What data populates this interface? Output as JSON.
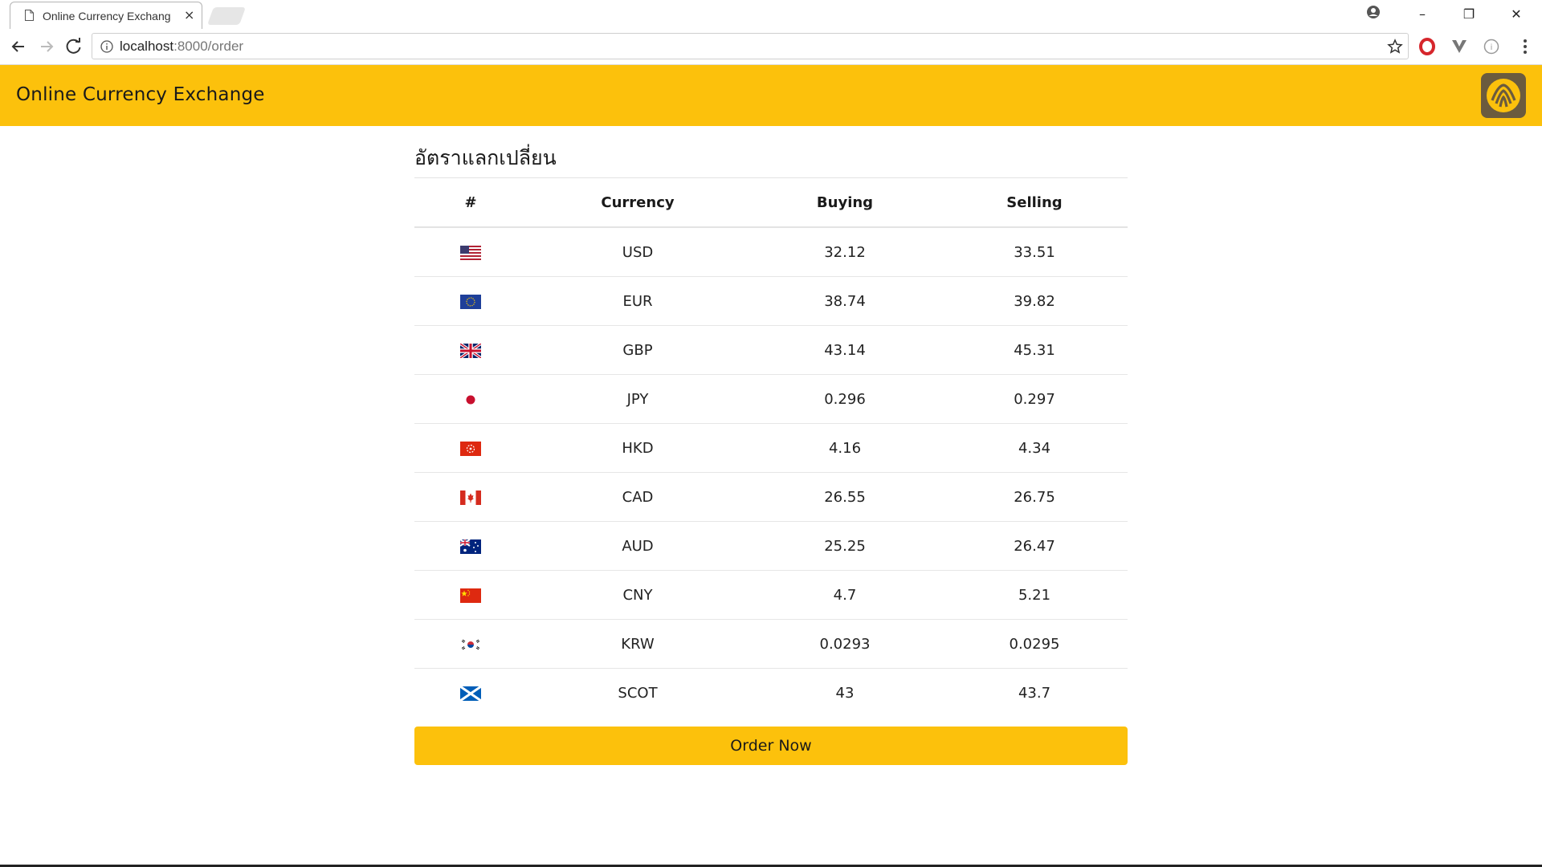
{
  "browser": {
    "tab_title": "Online Currency Exchang",
    "tab_close": "×",
    "url_host": "localhost",
    "url_path": ":8000/order",
    "window_controls": {
      "minimize": "–",
      "restore": "❐",
      "close": "✕"
    }
  },
  "header": {
    "brand": "Online Currency Exchange",
    "accent_color": "#fcc10c",
    "logo_icon": "krungsri-bank-logo-icon"
  },
  "main": {
    "title": "อัตราแลกเปลี่ยน",
    "columns": [
      "#",
      "Currency",
      "Buying",
      "Selling"
    ],
    "rows": [
      {
        "flag": "us-flag-icon",
        "currency": "USD",
        "buying": "32.12",
        "selling": "33.51"
      },
      {
        "flag": "eu-flag-icon",
        "currency": "EUR",
        "buying": "38.74",
        "selling": "39.82"
      },
      {
        "flag": "uk-flag-icon",
        "currency": "GBP",
        "buying": "43.14",
        "selling": "45.31"
      },
      {
        "flag": "jp-flag-icon",
        "currency": "JPY",
        "buying": "0.296",
        "selling": "0.297"
      },
      {
        "flag": "hk-flag-icon",
        "currency": "HKD",
        "buying": "4.16",
        "selling": "4.34"
      },
      {
        "flag": "ca-flag-icon",
        "currency": "CAD",
        "buying": "26.55",
        "selling": "26.75"
      },
      {
        "flag": "au-flag-icon",
        "currency": "AUD",
        "buying": "25.25",
        "selling": "26.47"
      },
      {
        "flag": "cn-flag-icon",
        "currency": "CNY",
        "buying": "4.7",
        "selling": "5.21"
      },
      {
        "flag": "kr-flag-icon",
        "currency": "KRW",
        "buying": "0.0293",
        "selling": "0.0295"
      },
      {
        "flag": "scot-flag-icon",
        "currency": "SCOT",
        "buying": "43",
        "selling": "43.7"
      }
    ],
    "order_button": "Order Now"
  }
}
